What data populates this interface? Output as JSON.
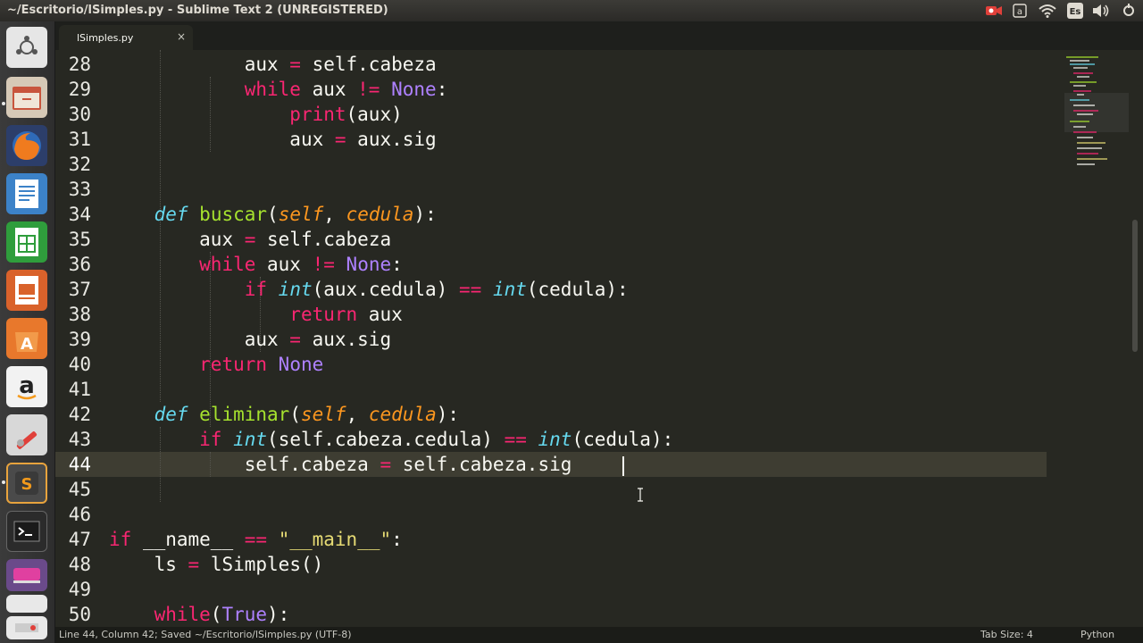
{
  "window": {
    "title": "~/Escritorio/lSimples.py - Sublime Text 2 (UNREGISTERED)"
  },
  "tray": {
    "keyboard_layout": "Es",
    "icons": [
      "recording-icon",
      "text-input-icon",
      "wifi-icon",
      "keyboard-icon",
      "volume-icon",
      "settings-icon"
    ]
  },
  "launcher": {
    "icons": [
      "dash-icon",
      "files-icon",
      "firefox-icon",
      "writer-icon",
      "calc-icon",
      "impress-icon",
      "software-center-icon",
      "amazon-icon",
      "system-settings-icon",
      "sublime-text-icon",
      "terminal-icon",
      "app-icon",
      "app-icon",
      "app-icon"
    ]
  },
  "tab": {
    "label": "lSimples.py",
    "close": "×"
  },
  "editor": {
    "line_numbers": [
      "28",
      "29",
      "30",
      "31",
      "32",
      "33",
      "34",
      "35",
      "36",
      "37",
      "38",
      "39",
      "40",
      "41",
      "42",
      "43",
      "44",
      "45",
      "46",
      "47",
      "48",
      "49",
      "50"
    ],
    "active_line": "44",
    "lines": {
      "l28": {
        "a": "aux",
        "b": " = ",
        "c": "self.cabeza"
      },
      "l29": {
        "a": "while",
        "b": " aux ",
        "c": "!=",
        "d": " ",
        "e": "None",
        "f": ":"
      },
      "l30": {
        "a": "print",
        "b": "(aux)"
      },
      "l31": {
        "a": "aux",
        "b": " = ",
        "c": "aux.sig"
      },
      "l34": {
        "a": "def",
        "b": " ",
        "c": "buscar",
        "d": "(",
        "e": "self",
        "f": ", ",
        "g": "cedula",
        "h": "):"
      },
      "l35": {
        "a": "aux",
        "b": " = ",
        "c": "self.cabeza"
      },
      "l36": {
        "a": "while",
        "b": " aux ",
        "c": "!=",
        "d": " ",
        "e": "None",
        "f": ":"
      },
      "l37": {
        "a": "if",
        "b": " ",
        "c": "int",
        "d": "(aux.cedula) ",
        "e": "==",
        "f": " ",
        "g": "int",
        "h": "(cedula):"
      },
      "l38": {
        "a": "return",
        "b": " aux"
      },
      "l39": {
        "a": "aux",
        "b": " = ",
        "c": "aux.sig"
      },
      "l40": {
        "a": "return",
        "b": " ",
        "c": "None"
      },
      "l42": {
        "a": "def",
        "b": " ",
        "c": "eliminar",
        "d": "(",
        "e": "self",
        "f": ", ",
        "g": "cedula",
        "h": "):"
      },
      "l43": {
        "a": "if",
        "b": " ",
        "c": "int",
        "d": "(self.cabeza.cedula) ",
        "e": "==",
        "f": " ",
        "g": "int",
        "h": "(cedula):"
      },
      "l44": {
        "a": "self.cabeza",
        "b": " = ",
        "c": "self.cabeza.sig"
      },
      "l47": {
        "a": "if",
        "b": " __name__ ",
        "c": "==",
        "d": " ",
        "e": "\"__main__\"",
        "f": ":"
      },
      "l48": {
        "a": "ls",
        "b": " = ",
        "c": "lSimples()"
      },
      "l50": {
        "a": "while",
        "b": "(",
        "c": "True",
        "d": "):"
      }
    }
  },
  "status": {
    "left": "Line 44, Column 42; Saved ~/Escritorio/lSimples.py (UTF-8)",
    "tab_size": "Tab Size: 4",
    "syntax": "Python"
  },
  "colors": {
    "background": "#272822",
    "keyword": "#f92672",
    "function": "#a6e22e",
    "storage": "#66d9ef",
    "parameter": "#fd971f",
    "constant": "#ae81ff",
    "string": "#e6db74"
  }
}
